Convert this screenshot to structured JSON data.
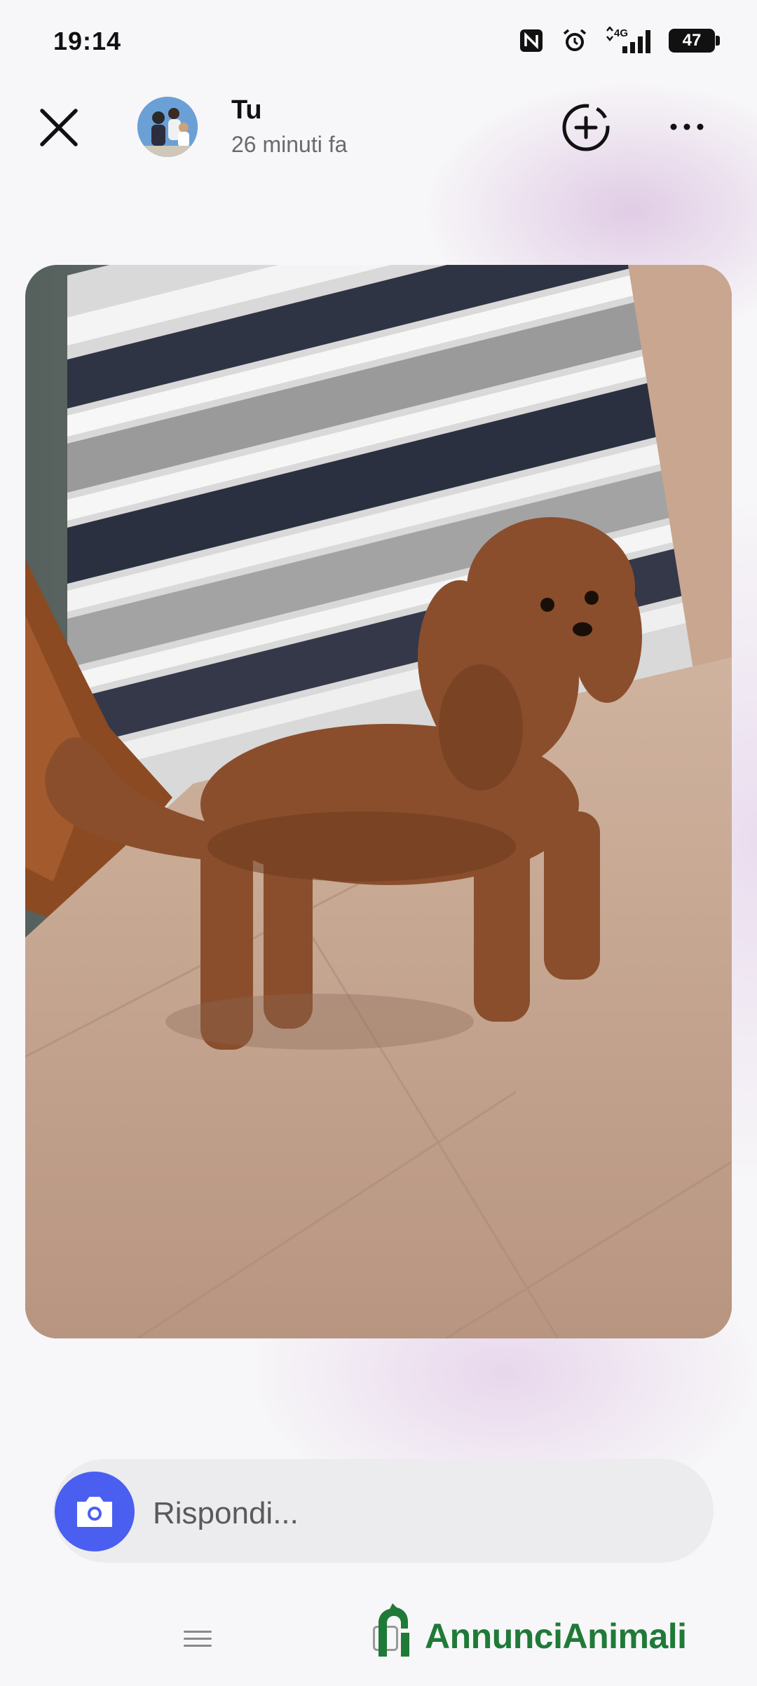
{
  "status_bar": {
    "time": "19:14",
    "network": "4G",
    "battery": "47",
    "icons": [
      "nfc-icon",
      "alarm-icon",
      "signal-icon",
      "battery-icon"
    ]
  },
  "header": {
    "user_name": "Tu",
    "time_ago": "26 minuti fa",
    "icons": [
      "close-icon",
      "add-story-icon",
      "more-icon"
    ]
  },
  "story": {
    "content": "photo"
  },
  "reply": {
    "placeholder": "Rispondi..."
  },
  "watermark": {
    "text": "AnnunciAnimali",
    "color": "#1f7a38"
  },
  "colors": {
    "accent": "#4a5ff0"
  }
}
